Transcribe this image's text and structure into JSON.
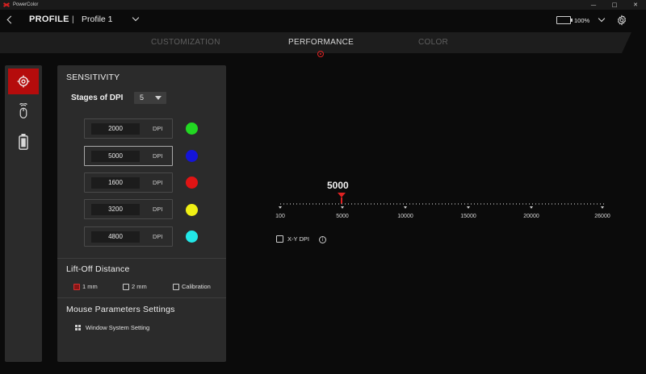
{
  "app": {
    "name": "PowerColor"
  },
  "window_controls": {
    "minimize": "—",
    "maximize": "□",
    "close": "✕"
  },
  "header": {
    "title": "PROFILE",
    "separator": "|",
    "profile_name": "Profile 1",
    "battery_pct": "100%",
    "battery_level": 1.0,
    "battery_color": "#2ed12e"
  },
  "tabs": [
    {
      "label": "CUSTOMIZATION",
      "active": false
    },
    {
      "label": "PERFORMANCE",
      "active": true
    },
    {
      "label": "COLOR",
      "active": false
    }
  ],
  "rail": [
    {
      "icon": "crosshair-icon",
      "active": true
    },
    {
      "icon": "mouse-wireless-icon",
      "active": false
    },
    {
      "icon": "battery-icon",
      "active": false
    }
  ],
  "sensitivity": {
    "title": "SENSITIVITY",
    "stages_label": "Stages of DPI",
    "stages_value": "5",
    "stages": [
      {
        "value": "2000",
        "unit": "DPI",
        "color": "#22d822",
        "active": false
      },
      {
        "value": "5000",
        "unit": "DPI",
        "color": "#1414d8",
        "active": true
      },
      {
        "value": "1600",
        "unit": "DPI",
        "color": "#e01414",
        "active": false
      },
      {
        "value": "3200",
        "unit": "DPI",
        "color": "#f0f014",
        "active": false
      },
      {
        "value": "4800",
        "unit": "DPI",
        "color": "#22e8e8",
        "active": false
      }
    ]
  },
  "lift_off": {
    "title": "Lift-Off Distance",
    "options": [
      {
        "label": "1 mm",
        "checked": true
      },
      {
        "label": "2 mm",
        "checked": false
      },
      {
        "label": "Calibration",
        "checked": false
      }
    ]
  },
  "mouse_params": {
    "title": "Mouse Parameters Settings",
    "windows_setting": "Window System Setting"
  },
  "dpi_slider": {
    "current_value": "5000",
    "min": 100,
    "max": 26000,
    "value": 5000,
    "tick_labels": [
      "100",
      "5000",
      "10000",
      "15000",
      "20000",
      "26000"
    ],
    "xy_label": "X-Y DPI",
    "xy_checked": false,
    "info_glyph": "i"
  },
  "colors": {
    "accent": "#e02222",
    "active_rail": "#b50c0c",
    "panel": "#2b2b2b"
  }
}
